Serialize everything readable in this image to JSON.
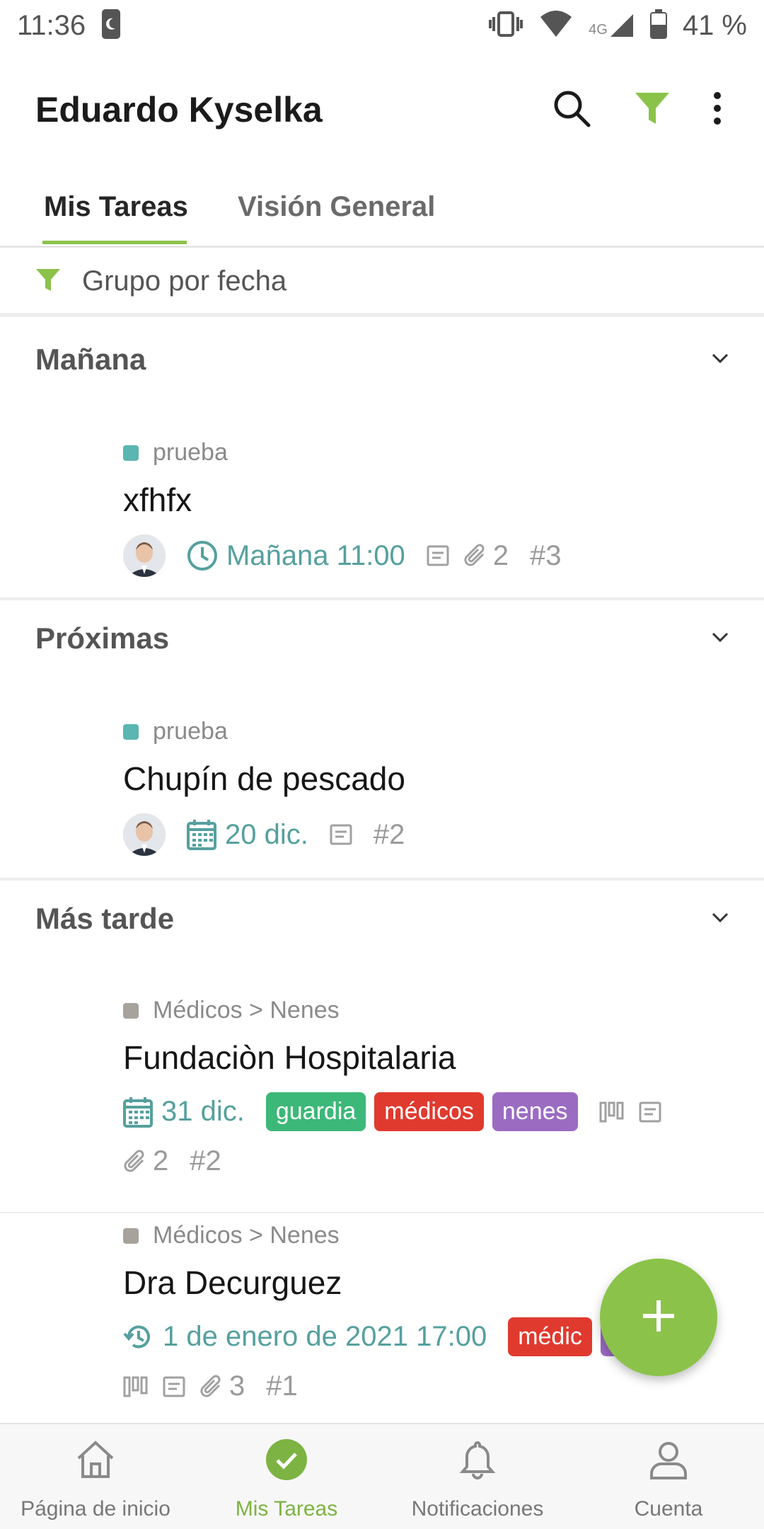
{
  "status_bar": {
    "time": "11:36",
    "battery": "41 %",
    "network": "4G"
  },
  "app_bar": {
    "title": "Eduardo Kyselka",
    "icons": [
      "search-icon",
      "filter-icon",
      "more-vert-icon"
    ]
  },
  "tabs": [
    {
      "label": "Mis Tareas",
      "active": true
    },
    {
      "label": "Visión General",
      "active": false
    }
  ],
  "group_filter": {
    "label": "Grupo por fecha"
  },
  "sections": [
    {
      "title": "Mañana",
      "tasks": [
        {
          "project": "prueba",
          "project_color": "#5bb5b0",
          "title": "xfhfx",
          "due": "Mañana 11:00",
          "due_icon": "clock-icon",
          "attachments": "2",
          "number": "#3"
        }
      ]
    },
    {
      "title": "Próximas",
      "tasks": [
        {
          "project": "prueba",
          "project_color": "#5bb5b0",
          "title": "Chupín de pescado",
          "due": "20 dic.",
          "due_icon": "calendar-icon",
          "number": "#2"
        }
      ]
    },
    {
      "title": "Más tarde",
      "tasks": [
        {
          "project": "Médicos > Nenes",
          "project_color": "#a8a29c",
          "title": "Fundaciòn Hospitalaria",
          "due": "31 dic.",
          "due_icon": "calendar-icon",
          "tags": [
            {
              "label": "guardia",
              "color": "#3cb878"
            },
            {
              "label": "médicos",
              "color": "#e03a2f"
            },
            {
              "label": "nenes",
              "color": "#9b6bc2"
            }
          ],
          "attachments": "2",
          "number": "#2"
        },
        {
          "project": "Médicos > Nenes",
          "project_color": "#a8a29c",
          "title": "Dra Decurguez",
          "due": "1 de enero de 2021 17:00",
          "due_icon": "repeat-clock-icon",
          "tags": [
            {
              "label": "médic",
              "color": "#e03a2f"
            },
            {
              "label": "s",
              "color": "#9b6bc2"
            }
          ],
          "attachments": "3",
          "number": "#1"
        }
      ]
    }
  ],
  "fab": {
    "icon": "plus-icon"
  },
  "bottom_nav": [
    {
      "label": "Página de inicio",
      "icon": "home-icon",
      "active": false
    },
    {
      "label": "Mis Tareas",
      "icon": "check-circle-icon",
      "active": true
    },
    {
      "label": "Notificaciones",
      "icon": "bell-icon",
      "active": false
    },
    {
      "label": "Cuenta",
      "icon": "person-icon",
      "active": false
    }
  ],
  "colors": {
    "accent": "#8bc34a",
    "due_text": "#55a09e"
  }
}
